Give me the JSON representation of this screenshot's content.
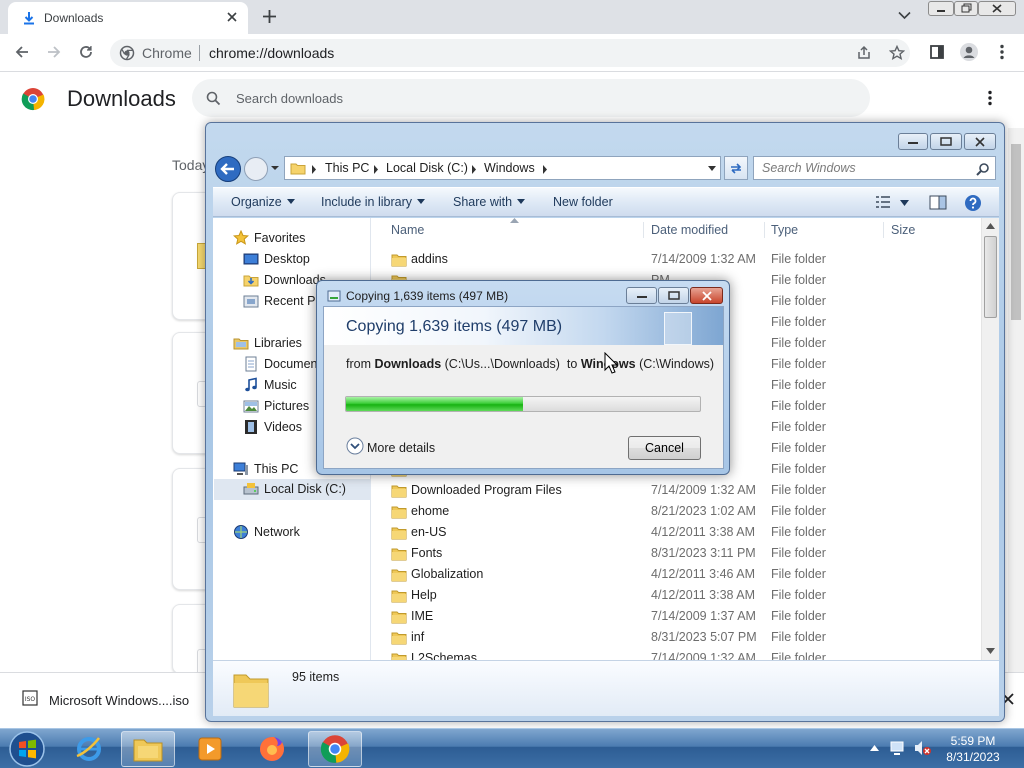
{
  "browser": {
    "tab_title": "Downloads",
    "omnibox_site": "Chrome",
    "omnibox_url": "chrome://downloads"
  },
  "downloads_page": {
    "title": "Downloads",
    "search_placeholder": "Search downloads",
    "date_header": "Today"
  },
  "shelf": {
    "item_name": "Microsoft Windows....iso"
  },
  "explorer": {
    "breadcrumb": [
      "This PC",
      "Local Disk (C:)",
      "Windows"
    ],
    "search_placeholder": "Search Windows",
    "commands": {
      "organize": "Organize",
      "include": "Include in library",
      "share": "Share with",
      "new_folder": "New folder"
    },
    "nav": {
      "favorites": "Favorites",
      "desktop": "Desktop",
      "downloads": "Downloads",
      "recent": "Recent Places",
      "libraries": "Libraries",
      "documents": "Documents",
      "music": "Music",
      "pictures": "Pictures",
      "videos": "Videos",
      "this_pc": "This PC",
      "local_disk": "Local Disk (C:)",
      "network": "Network"
    },
    "columns": {
      "name": "Name",
      "date": "Date modified",
      "type": "Type",
      "size": "Size"
    },
    "rows": [
      {
        "name": "addins",
        "date": "7/14/2009 1:32 AM",
        "type": "File folder"
      },
      {
        "name": "",
        "date": "PM",
        "type": "File folder"
      },
      {
        "name": "",
        "date": "PM",
        "type": "File folder"
      },
      {
        "name": "",
        "date": "PM",
        "type": "File folder"
      },
      {
        "name": "",
        "date": "PM",
        "type": "File folder"
      },
      {
        "name": "",
        "date": "PM",
        "type": "File folder"
      },
      {
        "name": "",
        "date": "PM",
        "type": "File folder"
      },
      {
        "name": "",
        "date": "PM",
        "type": "File folder"
      },
      {
        "name": "",
        "date": "PM",
        "type": "File folder"
      },
      {
        "name": "",
        "date": "PM",
        "type": "File folder"
      },
      {
        "name": "",
        "date": "PM",
        "type": "File folder"
      },
      {
        "name": "Downloaded Program Files",
        "date": "7/14/2009 1:32 AM",
        "type": "File folder"
      },
      {
        "name": "ehome",
        "date": "8/21/2023 1:02 AM",
        "type": "File folder"
      },
      {
        "name": "en-US",
        "date": "4/12/2011 3:38 AM",
        "type": "File folder"
      },
      {
        "name": "Fonts",
        "date": "8/31/2023 3:11 PM",
        "type": "File folder"
      },
      {
        "name": "Globalization",
        "date": "4/12/2011 3:46 AM",
        "type": "File folder"
      },
      {
        "name": "Help",
        "date": "4/12/2011 3:38 AM",
        "type": "File folder"
      },
      {
        "name": "IME",
        "date": "7/14/2009 1:37 AM",
        "type": "File folder"
      },
      {
        "name": "inf",
        "date": "8/31/2023 5:07 PM",
        "type": "File folder"
      },
      {
        "name": "L2Schemas",
        "date": "7/14/2009 1:32 AM",
        "type": "File folder"
      }
    ],
    "status": "95 items"
  },
  "copy_dialog": {
    "title": "Copying 1,639 items (497 MB)",
    "heading": "Copying 1,639 items (497 MB)",
    "from_label": "from",
    "from_name": "Downloads",
    "from_path": "(C:\\Us...\\Downloads)",
    "to_label": "to",
    "to_name": "Windows",
    "to_path": "(C:\\Windows)",
    "progress": 0.5,
    "more_details": "More details",
    "cancel": "Cancel"
  },
  "taskbar": {
    "time": "5:59 PM",
    "date": "8/31/2023"
  }
}
